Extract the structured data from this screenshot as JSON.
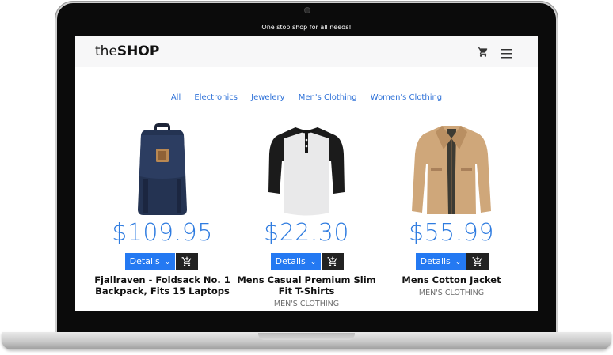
{
  "tagline": "One stop shop for all needs!",
  "brand": {
    "light": "the",
    "bold": "SHOP"
  },
  "categories": [
    "All",
    "Electronics",
    "Jewelery",
    "Men's Clothing",
    "Women's Clothing"
  ],
  "products": [
    {
      "price": "$109.95",
      "details_label": "Details",
      "title": "Fjallraven - Foldsack No. 1 Backpack, Fits 15 Laptops",
      "category": "",
      "icon": "backpack-image"
    },
    {
      "price": "$22.30",
      "details_label": "Details",
      "title": "Mens Casual Premium Slim Fit T-Shirts",
      "category": "MEN'S CLOTHING",
      "icon": "tshirt-image"
    },
    {
      "price": "$55.99",
      "details_label": "Details",
      "title": "Mens Cotton Jacket",
      "category": "MEN'S CLOTHING",
      "icon": "jacket-image"
    }
  ],
  "colors": {
    "accent": "#2479f2",
    "link": "#2f72d8",
    "price": "#2f7ce0",
    "dark_button": "#222222"
  }
}
